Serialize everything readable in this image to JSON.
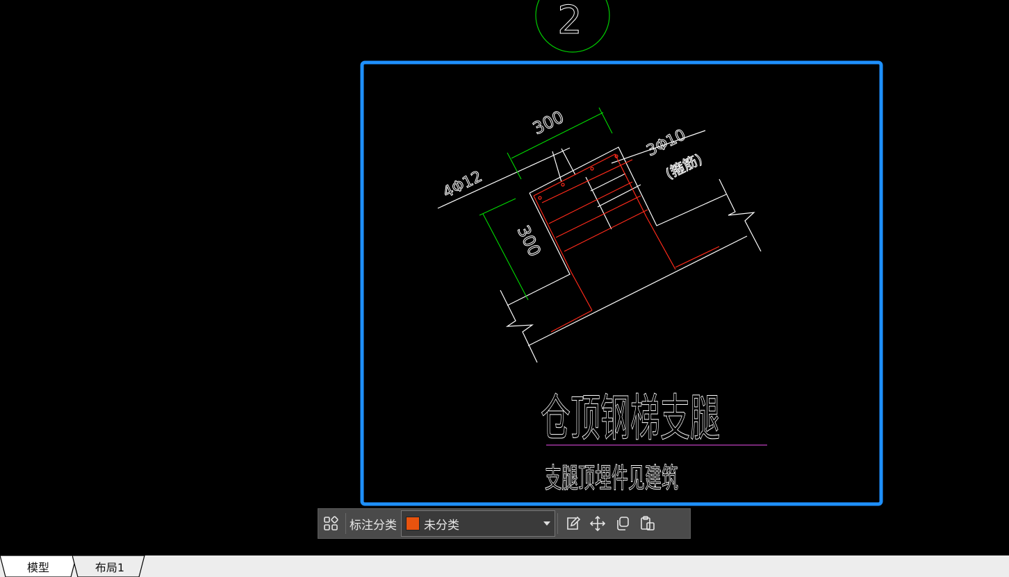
{
  "drawing": {
    "dim_top": "300",
    "dim_left": "300",
    "rebar_main": "4Φ12",
    "rebar_stirrup": "3Φ10",
    "rebar_stirrup_note": "(箍筋)",
    "bubble_number": "2",
    "title": "仓顶钢梯支腿",
    "subtitle": "支腿顶埋件见建筑"
  },
  "toolbar": {
    "label": "标注分类",
    "category_value": "未分类",
    "category_color": "#e8530e"
  },
  "tabs": [
    {
      "label": "模型",
      "active": true
    },
    {
      "label": "布局1",
      "active": false
    }
  ],
  "colors": {
    "selection": "#1e90ff",
    "dimension": "#00dd00",
    "rebar": "#ff2a1a",
    "underline": "#c040c0",
    "bubble": "#00cc00"
  }
}
